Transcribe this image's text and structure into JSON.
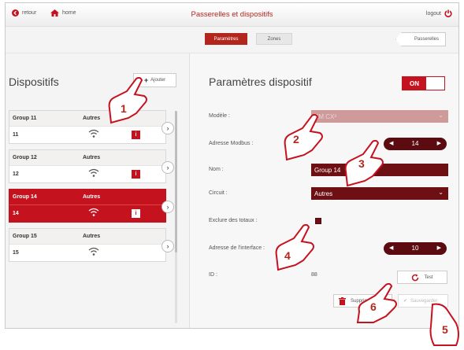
{
  "topbar": {
    "back_label": "retour",
    "home_label": "home",
    "title": "Passerelles et dispositifs",
    "logout_label": "logout"
  },
  "subbar": {
    "tabs": [
      {
        "label": "Paramètres",
        "active": true
      },
      {
        "label": "Zones",
        "active": false
      }
    ],
    "passerelles_label": "Passerelles"
  },
  "left": {
    "title": "Dispositifs",
    "add_label": "Ajouter",
    "devices": [
      {
        "name": "Group 11",
        "type": "Autres",
        "id": "11",
        "info": "i",
        "selected": false
      },
      {
        "name": "Group 12",
        "type": "Autres",
        "id": "12",
        "info": "i",
        "selected": false
      },
      {
        "name": "Group 14",
        "type": "Autres",
        "id": "14",
        "info": "i",
        "selected": true
      },
      {
        "name": "Group 15",
        "type": "Autres",
        "id": "15",
        "info": "",
        "selected": false
      }
    ]
  },
  "right": {
    "title": "Paramètres dispositif",
    "toggle_label": "ON",
    "fields": {
      "model_label": "Modèle :",
      "model_value": "EM CX³",
      "modbus_label": "Adresse Modbus :",
      "modbus_value": "14",
      "name_label": "Nom :",
      "name_value": "Group 14",
      "circuit_label": "Circuit :",
      "circuit_value": "Autres",
      "exclude_label": "Exclure des totaux :",
      "iface_label": "Adresse de l'interface :",
      "iface_value": "10",
      "id_label": "ID :",
      "id_value": "88"
    },
    "buttons": {
      "test_label": "Test",
      "delete_label": "Supprimer",
      "save_label": "Sauvegarder"
    }
  },
  "callouts": [
    "1",
    "2",
    "3",
    "4",
    "5",
    "6"
  ],
  "colors": {
    "accent": "#b3261e",
    "dark_field": "#6e0f14",
    "selected_row": "#c4121f"
  }
}
